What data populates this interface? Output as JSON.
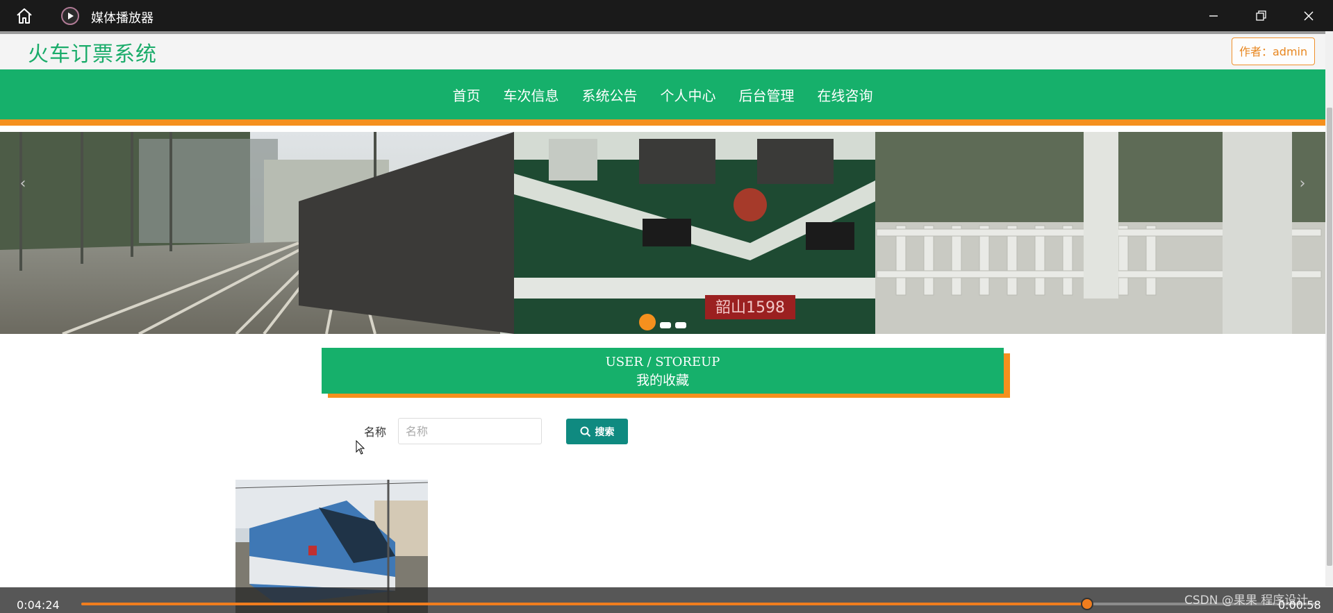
{
  "player": {
    "app_title": "媒体播放器",
    "current_time": "0:04:24",
    "remaining_time": "0:00:58",
    "progress_fraction": 0.8137,
    "accent_color": "#f07d1e"
  },
  "site": {
    "title": "火车订票系统",
    "author_badge": "作者：admin",
    "brand_color": "#16b06b",
    "accent_color": "#f5901e"
  },
  "nav": {
    "items": [
      "首页",
      "车次信息",
      "系统公告",
      "个人中心",
      "后台管理",
      "在线咨询"
    ]
  },
  "banner": {
    "train_plate": "韶山1598",
    "active_slide": 1,
    "slide_count": 3
  },
  "section": {
    "title_en": "USER / STOREUP",
    "title_cn": "我的收藏"
  },
  "search": {
    "label": "名称",
    "placeholder": "名称",
    "value": "",
    "button_label": "搜索"
  },
  "watermark": "CSDN @果果 程序设计"
}
